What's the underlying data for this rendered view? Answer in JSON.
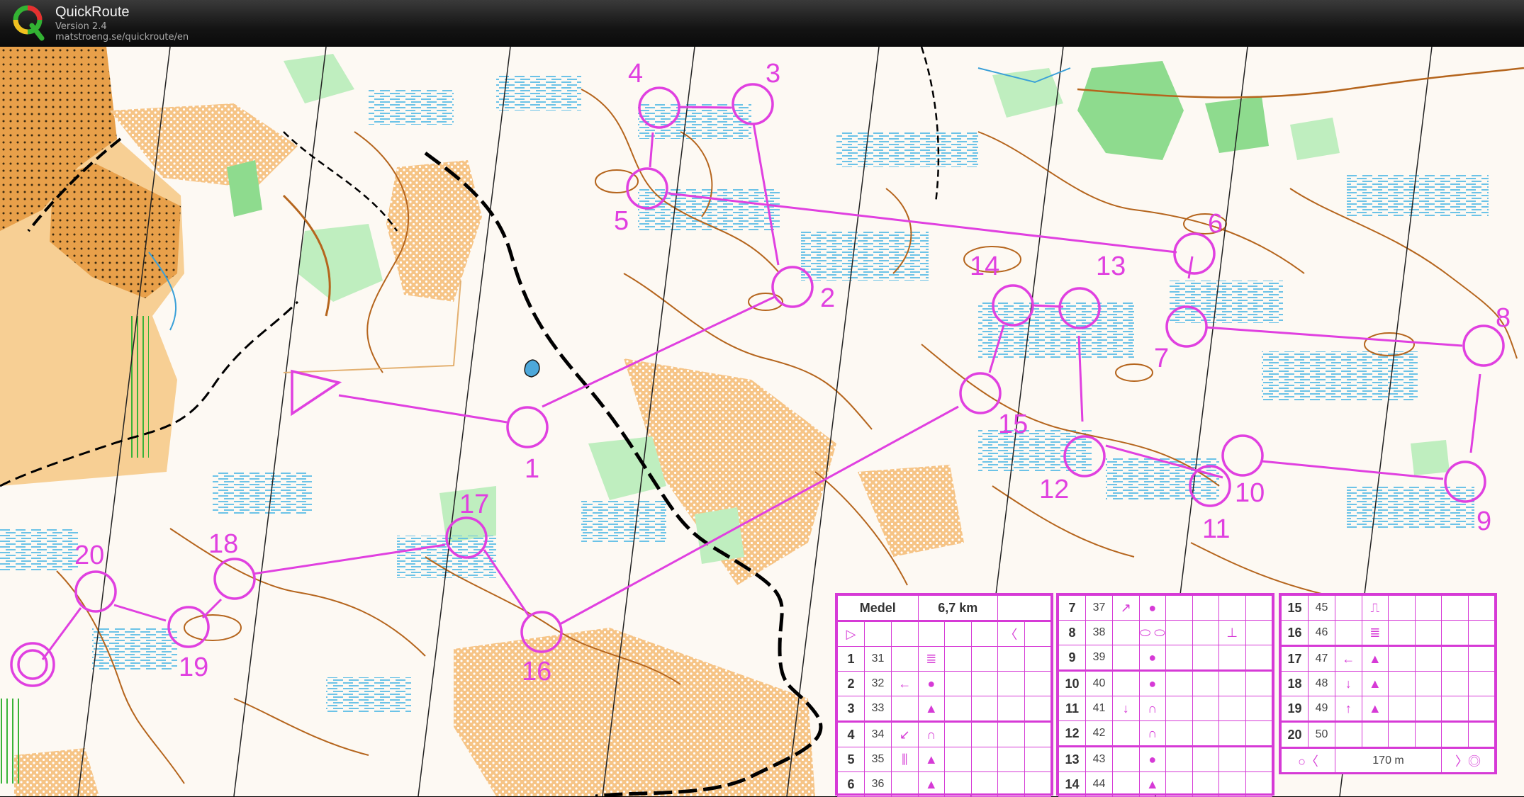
{
  "app": {
    "title": "QuickRoute",
    "version": "Version 2.4",
    "url": "matstroeng.se/quickroute/en"
  },
  "icons": {
    "logo": "quickroute-q-logo"
  },
  "colors": {
    "course": "#e040e0",
    "terrain_open": "#f7c98a",
    "forest_white": "#ffffff",
    "green": "#8ed98e",
    "marsh": "#6bc5e8",
    "contour": "#b5651d",
    "titlebar": "#1c1c1c"
  },
  "controls": [
    {
      "label": "1"
    },
    {
      "label": "2"
    },
    {
      "label": "3"
    },
    {
      "label": "4"
    },
    {
      "label": "5"
    },
    {
      "label": "6"
    },
    {
      "label": "7"
    },
    {
      "label": "8"
    },
    {
      "label": "9"
    },
    {
      "label": "10"
    },
    {
      "label": "11"
    },
    {
      "label": "12"
    },
    {
      "label": "13"
    },
    {
      "label": "14"
    },
    {
      "label": "15"
    },
    {
      "label": "16"
    },
    {
      "label": "17"
    },
    {
      "label": "18"
    },
    {
      "label": "19"
    },
    {
      "label": "20"
    }
  ],
  "description": {
    "header": {
      "class": "Medel",
      "length": "6,7 km"
    },
    "rows": [
      {
        "n": "1",
        "code": "31",
        "c": "",
        "d": "≣"
      },
      {
        "n": "2",
        "code": "32",
        "c": "←",
        "d": "●"
      },
      {
        "n": "3",
        "code": "33",
        "c": "",
        "d": "▲"
      },
      {
        "n": "4",
        "code": "34",
        "c": "↙",
        "d": "∩"
      },
      {
        "n": "5",
        "code": "35",
        "c": "⫼",
        "d": "▲"
      },
      {
        "n": "6",
        "code": "36",
        "c": "",
        "d": "▲"
      },
      {
        "n": "7",
        "code": "37",
        "c": "↗",
        "d": "●"
      },
      {
        "n": "8",
        "code": "38",
        "c": "",
        "d": "⬭ ⬭"
      },
      {
        "n": "9",
        "code": "39",
        "c": "",
        "d": "●"
      },
      {
        "n": "10",
        "code": "40",
        "c": "",
        "d": "●"
      },
      {
        "n": "11",
        "code": "41",
        "c": "↓",
        "d": "∩"
      },
      {
        "n": "12",
        "code": "42",
        "c": "",
        "d": "∩"
      },
      {
        "n": "13",
        "code": "43",
        "c": "",
        "d": "●"
      },
      {
        "n": "14",
        "code": "44",
        "c": "",
        "d": "▲"
      },
      {
        "n": "15",
        "code": "45",
        "c": "",
        "d": "⎍"
      },
      {
        "n": "16",
        "code": "46",
        "c": "",
        "d": "≣"
      },
      {
        "n": "17",
        "code": "47",
        "c": "←",
        "d": "▲"
      },
      {
        "n": "18",
        "code": "48",
        "c": "↓",
        "d": "▲"
      },
      {
        "n": "19",
        "code": "49",
        "c": "↑",
        "d": "▲"
      },
      {
        "n": "20",
        "code": "50",
        "c": "",
        "d": ""
      }
    ],
    "finish_distance": "170 m"
  }
}
